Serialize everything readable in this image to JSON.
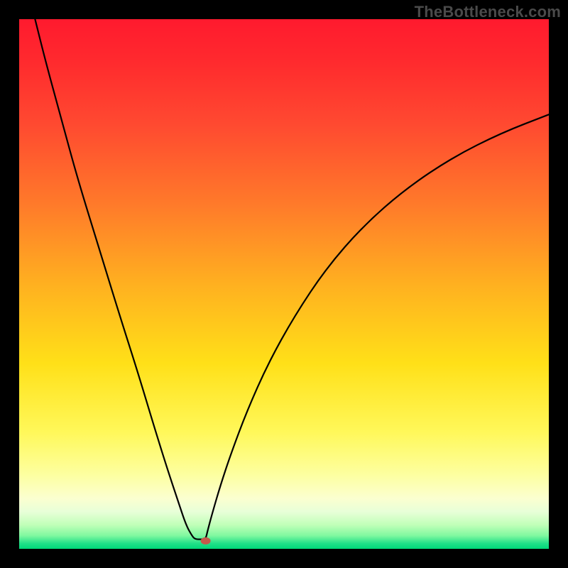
{
  "watermark": "TheBottleneck.com",
  "chart_data": {
    "type": "line",
    "title": "",
    "xlabel": "",
    "ylabel": "",
    "xlim": [
      0,
      1
    ],
    "ylim": [
      0,
      1
    ],
    "gradient_stops": [
      {
        "offset": 0.0,
        "color": "#ff1a2e"
      },
      {
        "offset": 0.08,
        "color": "#ff2a2e"
      },
      {
        "offset": 0.2,
        "color": "#ff4a30"
      },
      {
        "offset": 0.35,
        "color": "#ff7a2a"
      },
      {
        "offset": 0.5,
        "color": "#ffb020"
      },
      {
        "offset": 0.65,
        "color": "#ffe018"
      },
      {
        "offset": 0.78,
        "color": "#fff85a"
      },
      {
        "offset": 0.86,
        "color": "#fdffa0"
      },
      {
        "offset": 0.905,
        "color": "#fbffd0"
      },
      {
        "offset": 0.93,
        "color": "#e8ffd8"
      },
      {
        "offset": 0.955,
        "color": "#c0ffb8"
      },
      {
        "offset": 0.975,
        "color": "#80f8a0"
      },
      {
        "offset": 0.99,
        "color": "#20e088"
      },
      {
        "offset": 1.0,
        "color": "#00d878"
      }
    ],
    "curve": {
      "note": "V-shaped curve; y-axis inverted visually (0=top, 1=bottom). y≈0 means top of plot, y≈1 means bottom (green).",
      "points": [
        {
          "x": 0.03,
          "y": 0.0
        },
        {
          "x": 0.05,
          "y": 0.08
        },
        {
          "x": 0.08,
          "y": 0.19
        },
        {
          "x": 0.11,
          "y": 0.3
        },
        {
          "x": 0.15,
          "y": 0.43
        },
        {
          "x": 0.19,
          "y": 0.56
        },
        {
          "x": 0.225,
          "y": 0.67
        },
        {
          "x": 0.255,
          "y": 0.77
        },
        {
          "x": 0.28,
          "y": 0.85
        },
        {
          "x": 0.3,
          "y": 0.91
        },
        {
          "x": 0.315,
          "y": 0.955
        },
        {
          "x": 0.326,
          "y": 0.975
        },
        {
          "x": 0.332,
          "y": 0.982
        },
        {
          "x": 0.344,
          "y": 0.982
        },
        {
          "x": 0.352,
          "y": 0.982
        },
        {
          "x": 0.356,
          "y": 0.965
        },
        {
          "x": 0.364,
          "y": 0.935
        },
        {
          "x": 0.38,
          "y": 0.88
        },
        {
          "x": 0.4,
          "y": 0.82
        },
        {
          "x": 0.43,
          "y": 0.74
        },
        {
          "x": 0.47,
          "y": 0.65
        },
        {
          "x": 0.52,
          "y": 0.56
        },
        {
          "x": 0.58,
          "y": 0.47
        },
        {
          "x": 0.65,
          "y": 0.39
        },
        {
          "x": 0.73,
          "y": 0.32
        },
        {
          "x": 0.82,
          "y": 0.26
        },
        {
          "x": 0.91,
          "y": 0.215
        },
        {
          "x": 1.0,
          "y": 0.18
        }
      ]
    },
    "marker": {
      "x": 0.352,
      "y": 0.985,
      "rx": 7,
      "ry": 5,
      "fill": "#c55a4a"
    }
  }
}
